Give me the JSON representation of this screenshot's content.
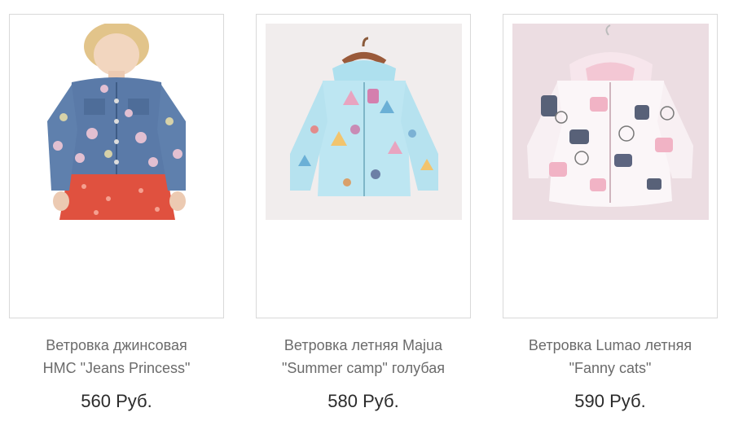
{
  "products": [
    {
      "name_line1": "Ветровка джинсовая",
      "name_line2": "HMC \"Jeans Princess\"",
      "price": "560 Руб.",
      "image_icon": "denim-jacket-photo"
    },
    {
      "name_line1": "Ветровка летняя Majua",
      "name_line2": "\"Summer camp\" голубая",
      "price": "580 Руб.",
      "image_icon": "light-blue-windbreaker-photo"
    },
    {
      "name_line1": "Ветровка Lumao летняя",
      "name_line2": "\"Fanny cats\"",
      "price": "590 Руб.",
      "image_icon": "cat-print-windbreaker-photo"
    }
  ],
  "colors": {
    "card_border": "#d9d9d9",
    "name_text": "#6b6b6b",
    "price_text": "#2b2b2b"
  }
}
